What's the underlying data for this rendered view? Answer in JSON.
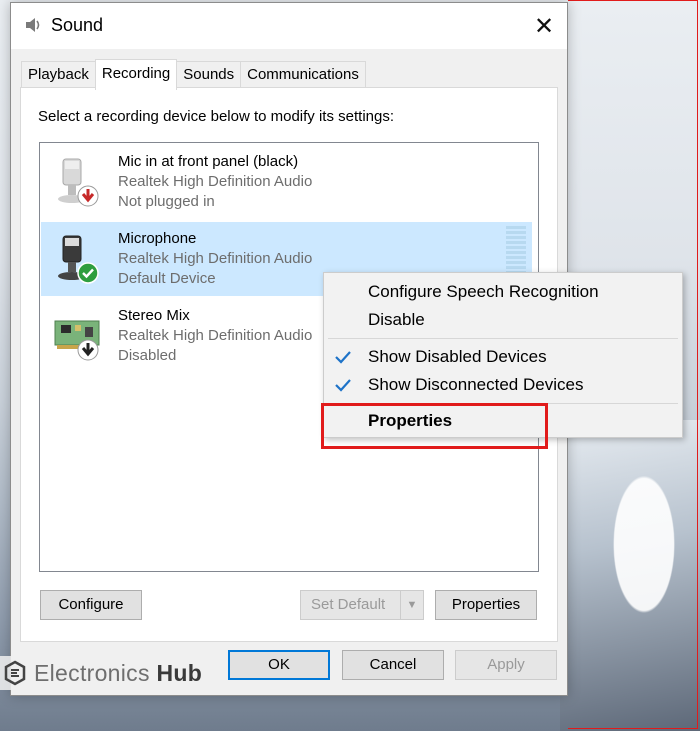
{
  "window": {
    "title": "Sound",
    "close_glyph": "✕"
  },
  "tabs": [
    {
      "label": "Playback"
    },
    {
      "label": "Recording"
    },
    {
      "label": "Sounds"
    },
    {
      "label": "Communications"
    }
  ],
  "active_tab": "Recording",
  "instruction": "Select a recording device below to modify its settings:",
  "devices": [
    {
      "name": "Mic in at front panel (black)",
      "driver": "Realtek High Definition Audio",
      "status": "Not plugged in",
      "badge": "down-arrow-red"
    },
    {
      "name": "Microphone",
      "driver": "Realtek High Definition Audio",
      "status": "Default Device",
      "badge": "check-green",
      "selected": true
    },
    {
      "name": "Stereo Mix",
      "driver": "Realtek High Definition Audio",
      "status": "Disabled",
      "badge": "down-arrow-black"
    }
  ],
  "buttons": {
    "configure": "Configure",
    "set_default": "Set Default",
    "properties": "Properties",
    "ok": "OK",
    "cancel": "Cancel",
    "apply": "Apply"
  },
  "context_menu": {
    "items": [
      {
        "label": "Configure Speech Recognition",
        "checked": false
      },
      {
        "label": "Disable",
        "checked": false
      },
      {
        "label": "Show Disabled Devices",
        "checked": true
      },
      {
        "label": "Show Disconnected Devices",
        "checked": true
      },
      {
        "label": "Properties",
        "checked": false,
        "bold": true
      }
    ]
  },
  "watermark": {
    "text": "Electronics",
    "bold": "Hub"
  },
  "colors": {
    "selection": "#cce8ff",
    "accent": "#0078d7",
    "highlight_red": "#e11b1b",
    "check_blue": "#1e73c8"
  }
}
